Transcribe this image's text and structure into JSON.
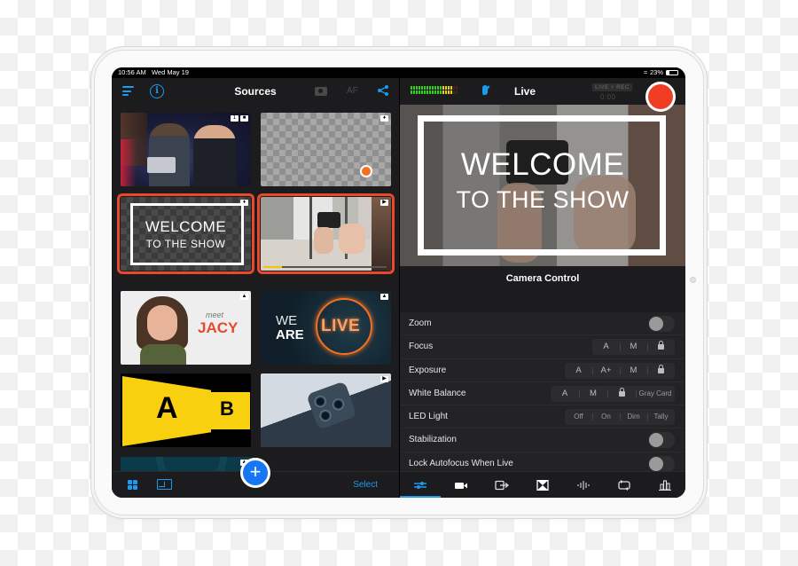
{
  "status_bar": {
    "time": "10:56 AM",
    "date": "Wed May 19",
    "battery": "23%",
    "battery_level": 0.23
  },
  "sources_panel": {
    "title": "Sources",
    "af_label": "AF",
    "icons": [
      "menu-icon",
      "info-icon",
      "camera-icon",
      "share-icon"
    ],
    "tiles": [
      {
        "name": "camera-source-hosts",
        "badges": [
          "1",
          "video-camera-icon"
        ],
        "selected": false
      },
      {
        "name": "logo-overlay",
        "badges": [
          "layers-icon"
        ],
        "selected": false
      },
      {
        "name": "welcome-title-overlay",
        "line1": "WELCOME",
        "line2": "TO THE SHOW",
        "badges": [
          "layers-icon"
        ],
        "selected": true
      },
      {
        "name": "video-source-phone-rig",
        "badges": [
          "play-icon"
        ],
        "selected": true,
        "progress": 0.15
      },
      {
        "name": "image-meet-jacy",
        "meet": "meet",
        "name_text": "JACY",
        "badges": [
          "image-icon"
        ],
        "selected": false
      },
      {
        "name": "image-we-are-live",
        "we": "WE",
        "are": "ARE",
        "live": "LIVE",
        "badges": [
          "image-icon"
        ],
        "selected": false
      },
      {
        "name": "ab-graphic",
        "a": "A",
        "b": "B",
        "badges": [],
        "selected": false
      },
      {
        "name": "video-phone-camera",
        "badges": [
          "play-icon"
        ],
        "selected": false
      },
      {
        "name": "image-teal-background",
        "badges": [
          "image-icon"
        ],
        "selected": false
      }
    ],
    "bottom": {
      "select_label": "Select",
      "add_label": "+"
    }
  },
  "live_panel": {
    "title": "Live",
    "rec_badge": "LIVE + REC",
    "rec_time": "0:00",
    "audio_meter": {
      "lit_green": 12,
      "lit_yellow": 4,
      "unlit": 2
    },
    "preview": {
      "line1": "WELCOME",
      "line2": "TO THE SHOW"
    },
    "camera_control": {
      "title": "Camera Control",
      "rows": [
        {
          "label": "Zoom",
          "type": "toggle",
          "on": false
        },
        {
          "label": "Focus",
          "type": "segment",
          "options": [
            "A",
            "M",
            "lock"
          ]
        },
        {
          "label": "Exposure",
          "type": "segment",
          "options": [
            "A",
            "A+",
            "M",
            "lock"
          ]
        },
        {
          "label": "White Balance",
          "type": "segment",
          "options": [
            "A",
            "M",
            "lock",
            "Gray Card"
          ]
        },
        {
          "label": "LED Light",
          "type": "segment",
          "options": [
            "Off",
            "On",
            "Dim",
            "Tally"
          ]
        },
        {
          "label": "Stabilization",
          "type": "toggle",
          "on": false
        },
        {
          "label": "Lock Autofocus When Live",
          "type": "toggle",
          "on": false
        }
      ]
    },
    "tabs": [
      {
        "name": "adjustments",
        "active": true
      },
      {
        "name": "camera",
        "active": false
      },
      {
        "name": "output",
        "active": false
      },
      {
        "name": "transitions",
        "active": false
      },
      {
        "name": "audio",
        "active": false
      },
      {
        "name": "switch-camera",
        "active": false
      },
      {
        "name": "stats",
        "active": false
      }
    ]
  },
  "colors": {
    "accent": "#1a9bf0",
    "selected_outline": "#e8492c",
    "record": "#f23d25",
    "add_button": "#1676f3"
  }
}
